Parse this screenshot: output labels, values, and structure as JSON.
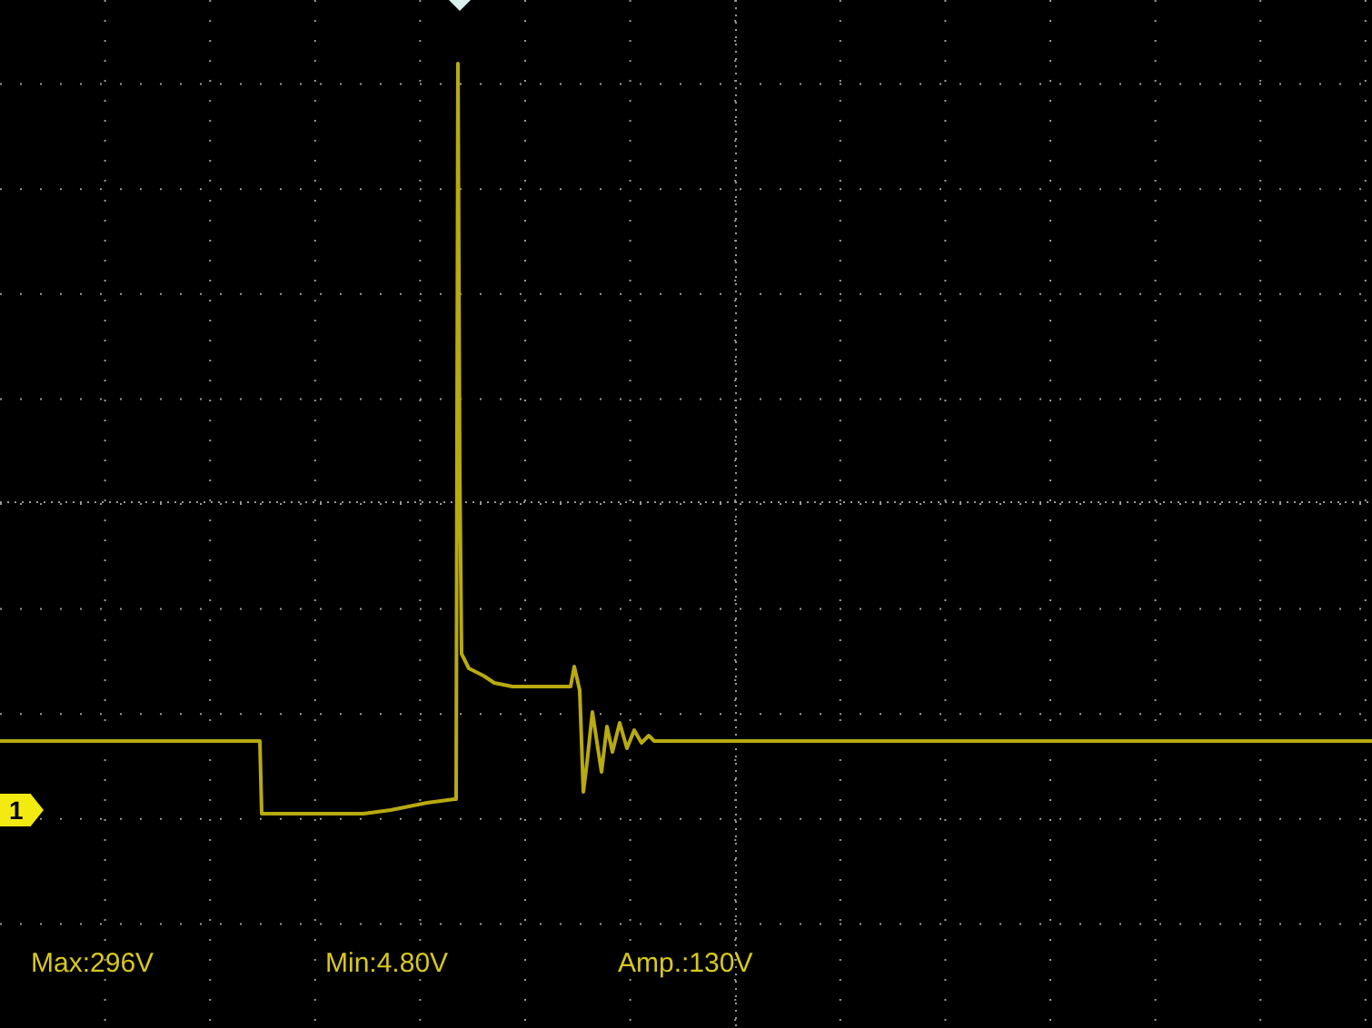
{
  "channel_marker": "1",
  "measurements": [
    "Max:296V",
    "Min:4.80V",
    "Amp.:130V"
  ]
}
